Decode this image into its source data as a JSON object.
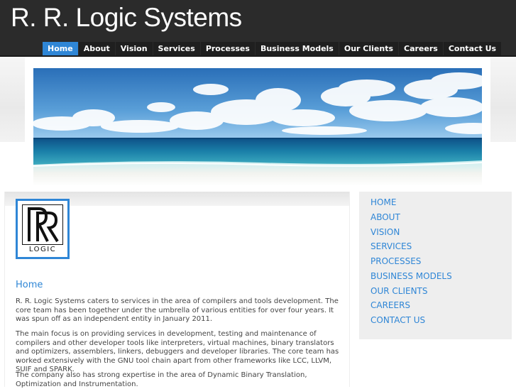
{
  "site": {
    "title": "R. R. Logic Systems"
  },
  "nav": {
    "items": [
      {
        "label": "Home",
        "active": true
      },
      {
        "label": "About"
      },
      {
        "label": "Vision"
      },
      {
        "label": "Services"
      },
      {
        "label": "Processes"
      },
      {
        "label": "Business Models"
      },
      {
        "label": "Our Clients"
      },
      {
        "label": "Careers"
      },
      {
        "label": "Contact Us"
      }
    ]
  },
  "logo": {
    "text": "LOGIC"
  },
  "content": {
    "heading": "Home",
    "paragraphs": [
      "R. R. Logic Systems caters to services in the area of compilers and tools development.  The core team has been together under the umbrella of various entities for over four years.  It was spun off as an independent entity in January 2011.",
      "The main focus is on providing services in development, testing and maintenance of compilers and other developer tools like interpreters, virtual machines, binary translators and optimizers, assemblers, linkers, debuggers and developer libraries.  The core team has worked extensively with the GNU tool chain apart from other frameworks like LCC, LLVM, SUIF and SPARK.",
      "The company also has strong expertise in the area of Dynamic Binary Translation, Optimization and Instrumentation."
    ]
  },
  "sidebar": {
    "items": [
      {
        "label": "HOME"
      },
      {
        "label": "ABOUT"
      },
      {
        "label": "VISION"
      },
      {
        "label": "SERVICES"
      },
      {
        "label": "PROCESSES"
      },
      {
        "label": "BUSINESS MODELS"
      },
      {
        "label": "OUR CLIENTS"
      },
      {
        "label": "CAREERS"
      },
      {
        "label": "CONTACT US"
      }
    ]
  },
  "colors": {
    "header_bg": "#2b2b2b",
    "nav_active": "#2f86d6",
    "link": "#2f86d6",
    "body_text": "#444444"
  }
}
